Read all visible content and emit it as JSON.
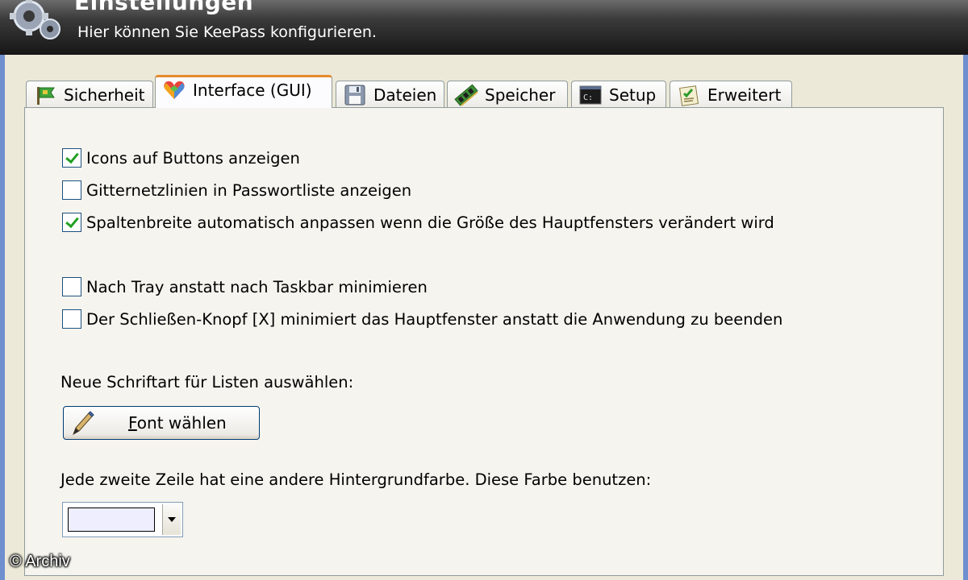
{
  "header": {
    "title": "Einstellungen",
    "subtitle": "Hier können Sie KeePass konfigurieren."
  },
  "tabs": [
    {
      "label": "Sicherheit",
      "icon": "flag-icon",
      "active": false
    },
    {
      "label": "Interface (GUI)",
      "icon": "heart-colors-icon",
      "active": true
    },
    {
      "label": "Dateien",
      "icon": "floppy-disk-icon",
      "active": false
    },
    {
      "label": "Speicher",
      "icon": "memory-chip-icon",
      "active": false
    },
    {
      "label": "Setup",
      "icon": "console-icon",
      "active": false
    },
    {
      "label": "Erweitert",
      "icon": "checklist-icon",
      "active": false
    }
  ],
  "options": {
    "icons_on_buttons": {
      "label": "Icons auf Buttons anzeigen",
      "checked": true
    },
    "gridlines": {
      "label": "Gitternetzlinien in Passwortliste anzeigen",
      "checked": false
    },
    "auto_column_width": {
      "label": "Spaltenbreite automatisch anpassen wenn die Größe des Hauptfensters verändert wird",
      "checked": true
    },
    "minimize_to_tray": {
      "label": "Nach Tray anstatt nach Taskbar minimieren",
      "checked": false
    },
    "close_minimizes": {
      "label": "Der Schließen-Knopf [X] minimiert das Hauptfenster anstatt die Anwendung zu beenden",
      "checked": false
    }
  },
  "font": {
    "label": "Neue Schriftart für Listen auswählen:",
    "button_access_key": "F",
    "button_rest": "ont wählen",
    "icon": "pencil-icon"
  },
  "row_color": {
    "label": "Jede zweite Zeile hat eine andere Hintergrundfarbe. Diese Farbe benutzen:",
    "color": "#eeeeff"
  },
  "watermark": "© Archiv",
  "colors": {
    "active_tab_accent": "#e68b2c",
    "checkmark": "#21a121",
    "header_dark": "#161616"
  }
}
